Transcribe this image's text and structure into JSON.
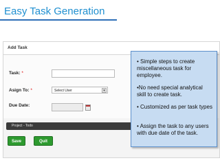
{
  "slide": {
    "title": "Easy Task Generation"
  },
  "panel": {
    "header": "Add Task"
  },
  "form": {
    "task_label": "Task:",
    "assign_label": "Asign To:",
    "assign_value": "Select User",
    "due_label": "Due Date:",
    "required_mark": "*"
  },
  "project_bar": {
    "text": "Project - Todo"
  },
  "buttons": {
    "save": "Save",
    "quit": "Quit"
  },
  "tooltip": {
    "points": [
      "• Simple steps to create miscellaneous task for employee.",
      "•No need special analytical skill to create task.",
      "• Customized as per task types",
      "• Assign the task to any users with due date of the task."
    ]
  },
  "colors": {
    "title": "#1f8fd0",
    "button": "#2d9a2f",
    "tooltip_bg": "#c7dcf2",
    "tooltip_border": "#5c8fcb"
  }
}
